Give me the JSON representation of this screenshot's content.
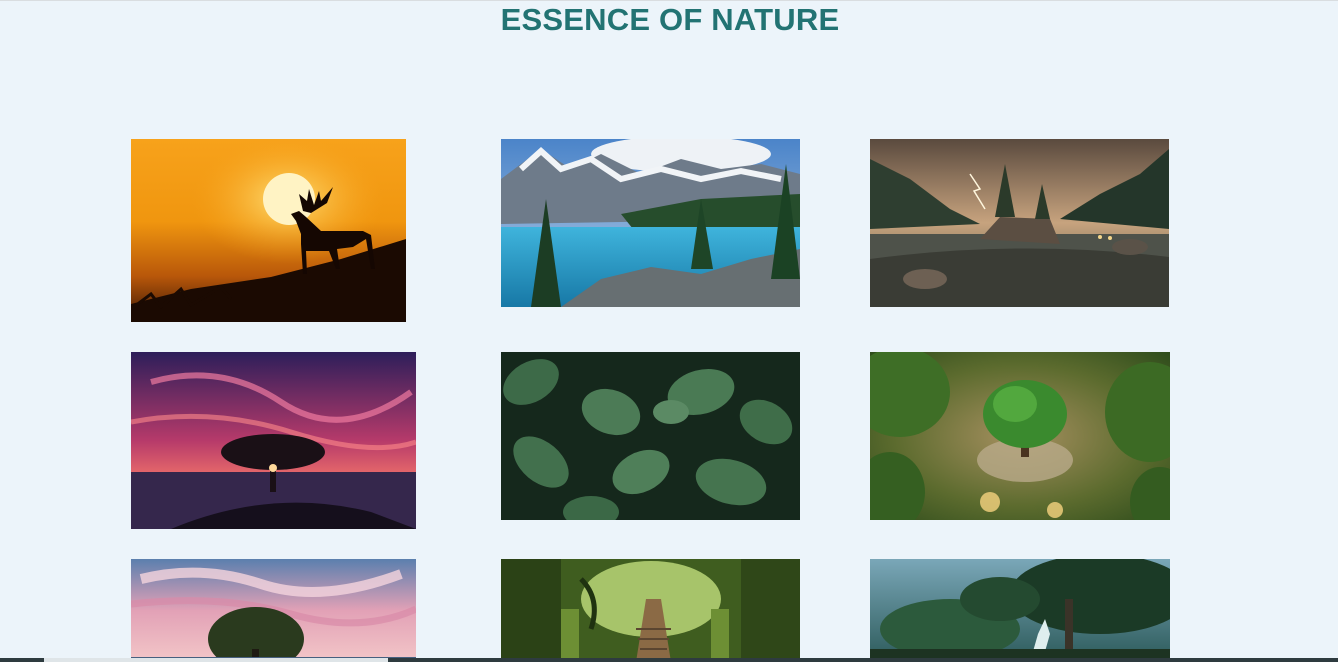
{
  "header": {
    "title": "ESSENCE OF NATURE"
  },
  "gallery": {
    "images": [
      {
        "icon": "deer-sunset-image"
      },
      {
        "icon": "mountain-lake-image"
      },
      {
        "icon": "stormy-lake-image"
      },
      {
        "icon": "tree-pink-sky-image"
      },
      {
        "icon": "green-leaves-image"
      },
      {
        "icon": "tree-globe-image"
      },
      {
        "icon": "tree-cloudy-sky-image"
      },
      {
        "icon": "forest-path-image"
      },
      {
        "icon": "forest-waterfall-image"
      }
    ]
  },
  "colors": {
    "background": "#ecf4fa",
    "title": "#227373"
  }
}
